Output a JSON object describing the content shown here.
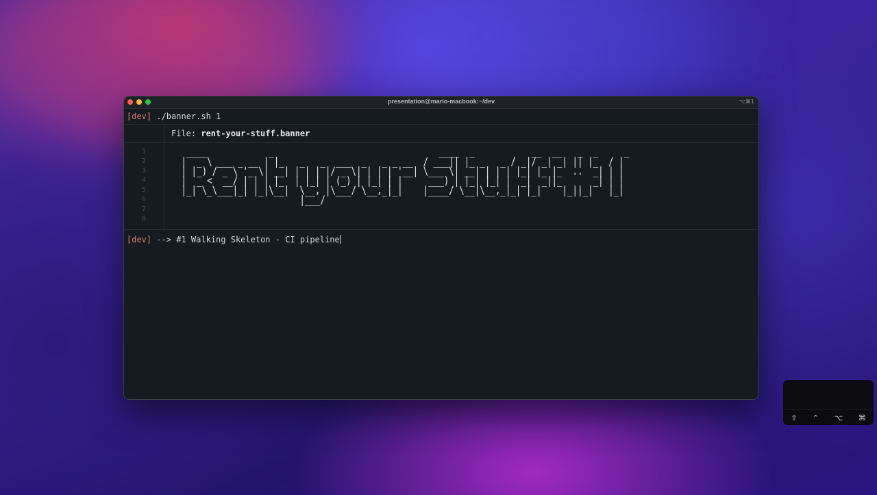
{
  "window": {
    "title": "presentation@mario-macbook:~/dev",
    "shortcut": "⌥⌘1"
  },
  "terminal": {
    "line1": {
      "tag": "[dev]",
      "command": " ./banner.sh 1"
    },
    "file_label": "File: ",
    "file_name": "rent-your-stuff.banner",
    "line_numbers": [
      "1",
      "2",
      "3",
      "4",
      "5",
      "6",
      "7",
      "8"
    ],
    "banner_ascii": "  ____            _                                ____  _           __  __   _  _     _ \n |  _ \\ ___ _ __ | |_   _   _  ___  _   _ _ __  / ___|| |_ _   _ / _|/ _| _| || |_  / |\n | |_) / _ \\ '_ \\| __| | | | |/ _ \\| | | | '__| \\___ \\| __| | | | |_| |_ |_  ..  _| | |\n |  _ <  __/ | | | |_  | |_| | (_) | |_| | |     ___) | |_| |_| |  _|  _||_      _| | |\n |_| \\_\\___|_| |_|\\__|  \\__, |\\___/ \\__,_|_|    |____/ \\__|\\__,_|_| |_|    |_||_|   |_|\n                        |___/                                                          ",
    "line2": {
      "tag": "[dev]",
      "text": " --> #1 Walking Skeleton - CI pipeline"
    }
  },
  "keycast": {
    "keys": [
      "⇧",
      "⌃",
      "⌥",
      "⌘"
    ]
  }
}
